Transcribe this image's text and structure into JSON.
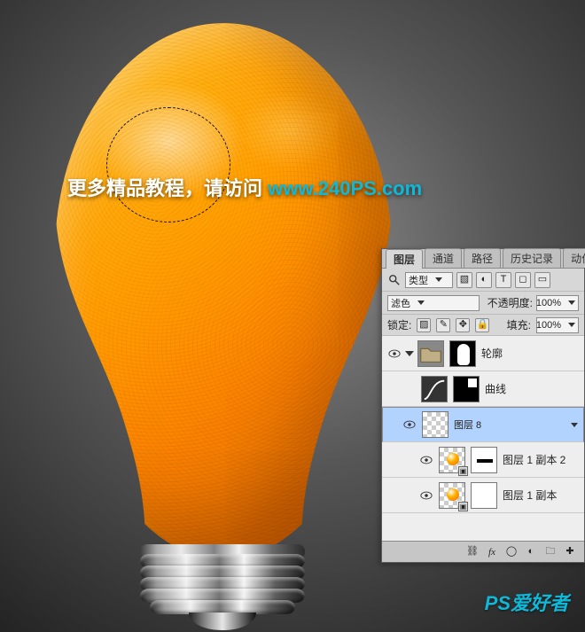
{
  "overlay": {
    "text_cn": "更多精品教程，请访问 ",
    "url": "www.240PS.com"
  },
  "watermark": "PS爱好者",
  "panel": {
    "tabs": [
      "图层",
      "通道",
      "路径",
      "历史记录",
      "动作"
    ],
    "active_tab": 0,
    "filter_kind": "类型",
    "blend_mode": "滤色",
    "opacity_label": "不透明度:",
    "opacity_value": "100%",
    "lock_label": "锁定:",
    "fill_label": "填充:",
    "fill_value": "100%",
    "layers": [
      {
        "eye": true,
        "type": "group",
        "name": "轮廓",
        "open": true,
        "nest": 0
      },
      {
        "eye": false,
        "type": "curves",
        "name": "曲线",
        "open": false,
        "nest": 1
      },
      {
        "eye": true,
        "type": "raster",
        "name": "图层 8",
        "selected": true,
        "nest": 1
      },
      {
        "eye": true,
        "type": "smart",
        "name": "图层 1 副本 2",
        "nest": 2
      },
      {
        "eye": true,
        "type": "smart2",
        "name": "图层 1 副本",
        "nest": 2
      }
    ]
  }
}
